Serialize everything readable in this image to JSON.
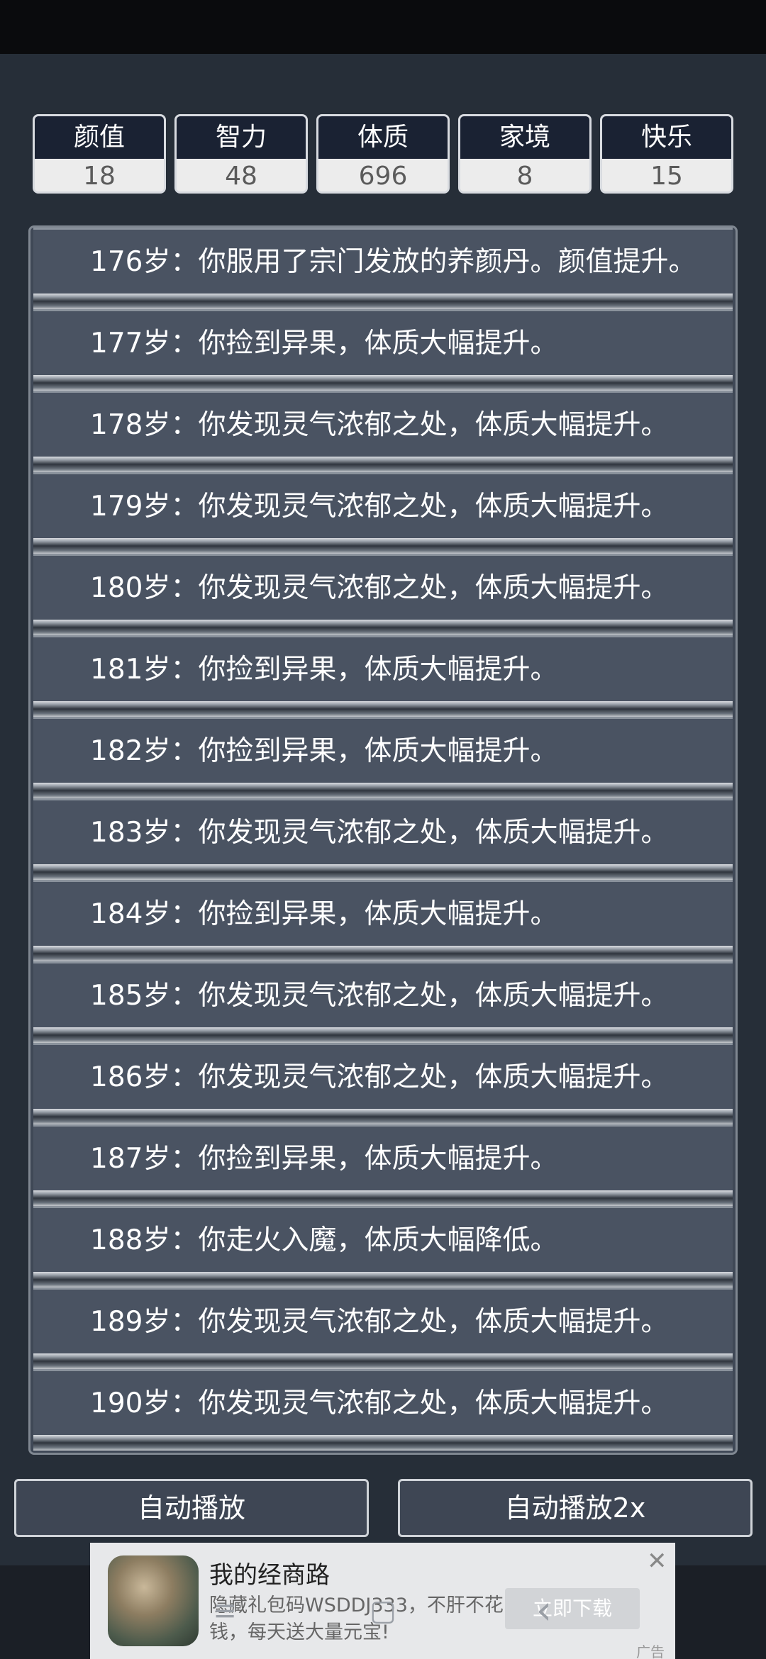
{
  "stats": [
    {
      "label": "颜值",
      "value": "18"
    },
    {
      "label": "智力",
      "value": "48"
    },
    {
      "label": "体质",
      "value": "696"
    },
    {
      "label": "家境",
      "value": "8"
    },
    {
      "label": "快乐",
      "value": "15"
    }
  ],
  "log": [
    "176岁：你服用了宗门发放的养颜丹。颜值提升。",
    "177岁：你捡到异果，体质大幅提升。",
    "178岁：你发现灵气浓郁之处，体质大幅提升。",
    "179岁：你发现灵气浓郁之处，体质大幅提升。",
    "180岁：你发现灵气浓郁之处，体质大幅提升。",
    "181岁：你捡到异果，体质大幅提升。",
    "182岁：你捡到异果，体质大幅提升。",
    "183岁：你发现灵气浓郁之处，体质大幅提升。",
    "184岁：你捡到异果，体质大幅提升。",
    "185岁：你发现灵气浓郁之处，体质大幅提升。",
    "186岁：你发现灵气浓郁之处，体质大幅提升。",
    "187岁：你捡到异果，体质大幅提升。",
    "188岁：你走火入魔，体质大幅降低。",
    "189岁：你发现灵气浓郁之处，体质大幅提升。",
    "190岁：你发现灵气浓郁之处，体质大幅提升。"
  ],
  "buttons": {
    "auto_play": "自动播放",
    "auto_play_2x": "自动播放2x"
  },
  "ad": {
    "title": "我的经商路",
    "desc": "隐藏礼包码WSDDJ333，不肝不花钱，每天送大量元宝!",
    "cta": "立即下载",
    "close": "✕",
    "tag": "广告"
  },
  "nav": {
    "menu_icon": "≡",
    "home_icon": "▢",
    "back_icon": "‹"
  },
  "colors": {
    "background": "#262e38",
    "stat_header": "#1a2233",
    "row": "#4a5362"
  }
}
